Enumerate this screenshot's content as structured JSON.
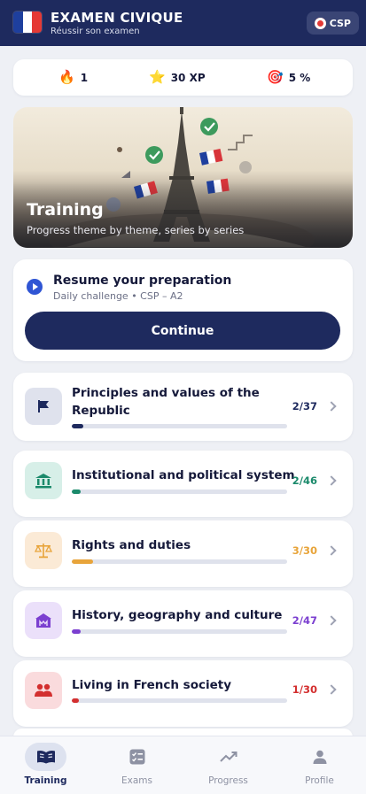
{
  "header": {
    "title": "EXAMEN CIVIQUE",
    "subtitle": "Réussir son examen",
    "badge_label": "CSP",
    "flag_colors": [
      "#1e3f9e",
      "#ffffff",
      "#e53935"
    ],
    "bg_color": "#1e2a5e"
  },
  "stats": [
    {
      "icon": "fire-icon",
      "glyph": "🔥",
      "value": "1"
    },
    {
      "icon": "star-icon",
      "glyph": "⭐",
      "value": "30 XP"
    },
    {
      "icon": "target-icon",
      "glyph": "🎯",
      "value": "5 %"
    }
  ],
  "hero": {
    "title": "Training",
    "subtitle": "Progress theme by theme, series by series"
  },
  "resume": {
    "title": "Resume your preparation",
    "subtitle": "Daily challenge • CSP – A2",
    "button_label": "Continue"
  },
  "themes": [
    {
      "line1": "Principles and values of the",
      "line2": "Republic",
      "count": "2/37",
      "progress": 0.054,
      "color": "#1e2a5e",
      "icon_bg": "#dfe2ed",
      "icon": "flag-icon"
    },
    {
      "line1": "Institutional and political system",
      "line2": "",
      "count": "2/46",
      "progress": 0.043,
      "color": "#1b8a6b",
      "icon_bg": "#d7efe8",
      "icon": "institution-icon"
    },
    {
      "line1": "Rights and duties",
      "line2": "",
      "count": "3/30",
      "progress": 0.1,
      "color": "#e8a43a",
      "icon_bg": "#fbead6",
      "icon": "scales-icon"
    },
    {
      "line1": "History, geography and culture",
      "line2": "",
      "count": "2/47",
      "progress": 0.043,
      "color": "#7b3fd0",
      "icon_bg": "#ebe0fa",
      "icon": "museum-icon"
    },
    {
      "line1": "Living in French society",
      "line2": "",
      "count": "1/30",
      "progress": 0.033,
      "color": "#d32f2f",
      "icon_bg": "#fadbdd",
      "icon": "people-icon"
    }
  ],
  "tabs": [
    {
      "label": "Training",
      "icon": "book-icon",
      "active": true
    },
    {
      "label": "Exams",
      "icon": "exam-icon",
      "active": false
    },
    {
      "label": "Progress",
      "icon": "trend-icon",
      "active": false
    },
    {
      "label": "Profile",
      "icon": "person-icon",
      "active": false
    }
  ]
}
